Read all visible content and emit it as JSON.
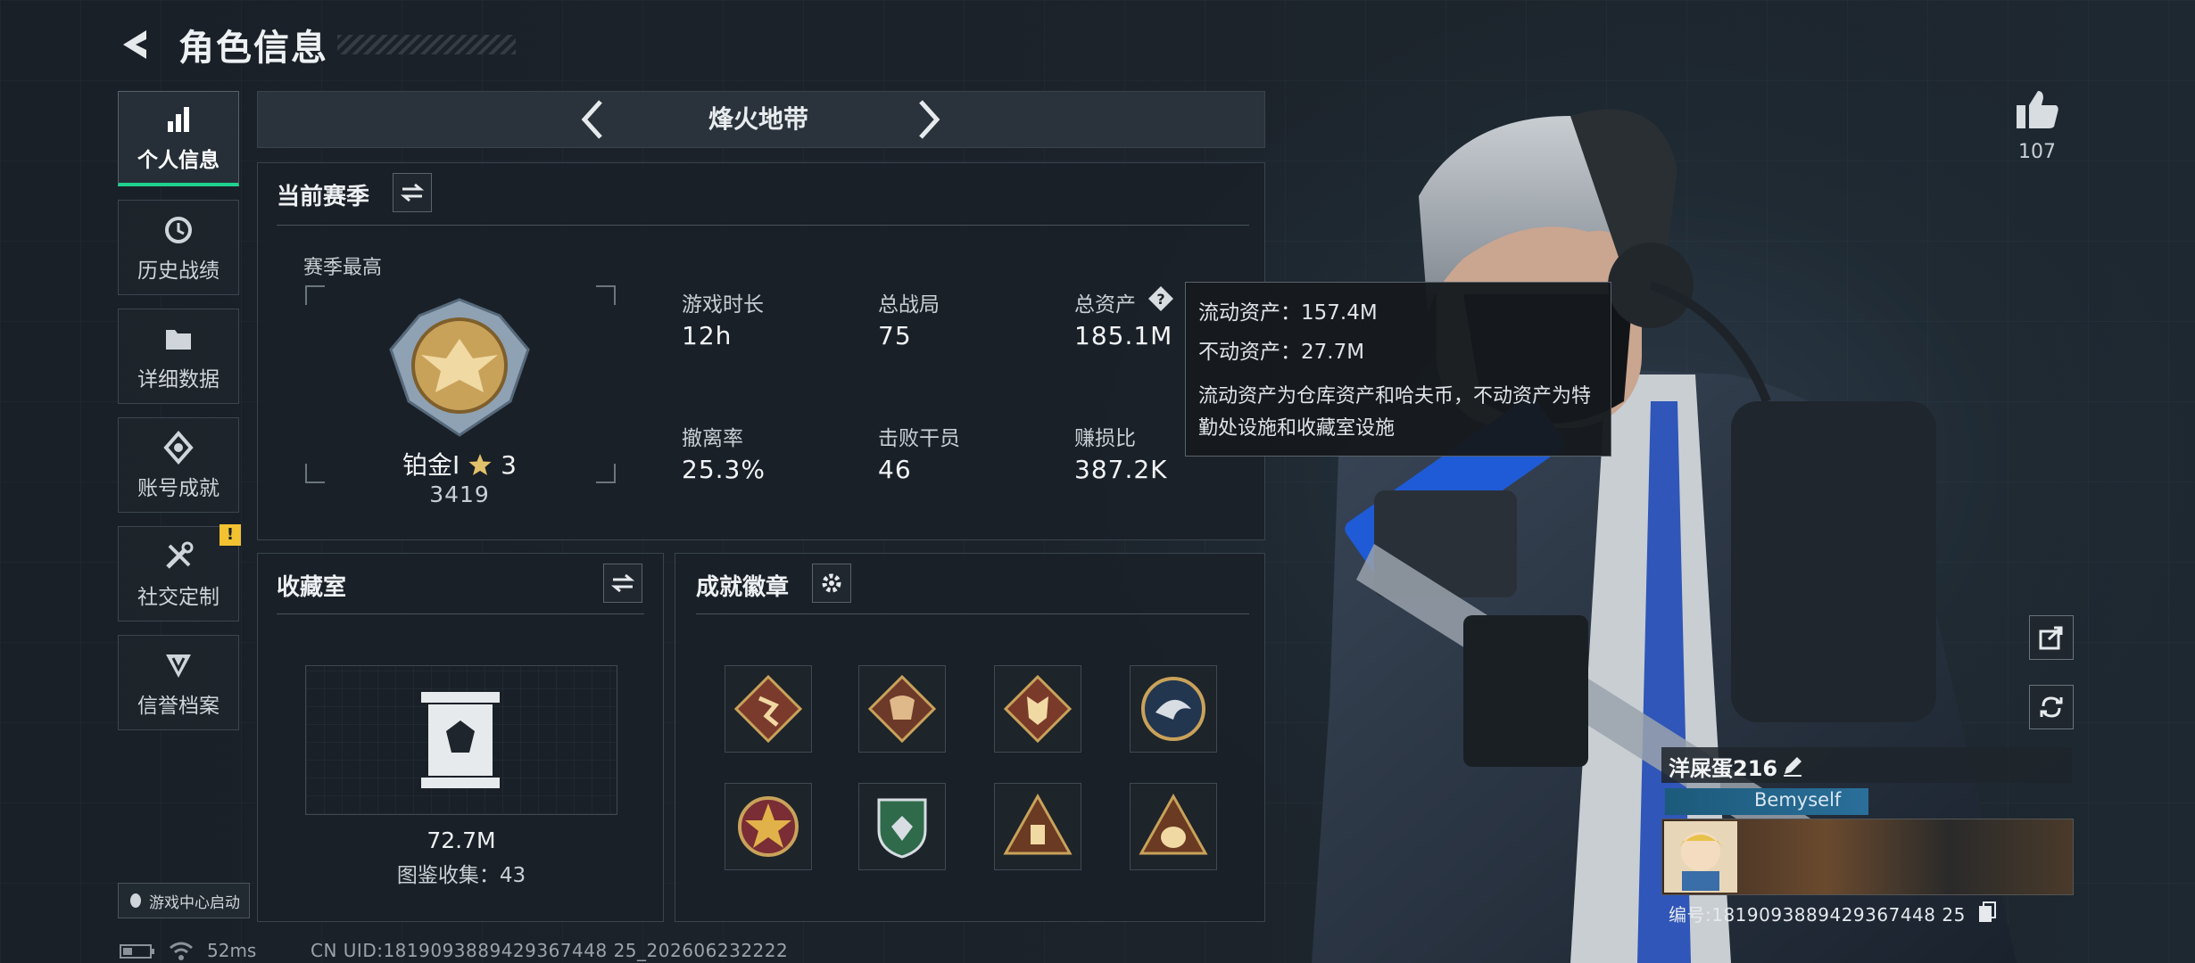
{
  "header": {
    "title": "角色信息"
  },
  "sidebar": {
    "items": [
      {
        "label": "个人信息",
        "icon": "bar-chart-icon",
        "active": true
      },
      {
        "label": "历史战绩",
        "icon": "history-icon"
      },
      {
        "label": "详细数据",
        "icon": "folder-icon"
      },
      {
        "label": "账号成就",
        "icon": "achievement-icon"
      },
      {
        "label": "社交定制",
        "icon": "tools-icon",
        "alert": "!"
      },
      {
        "label": "信誉档案",
        "icon": "credit-icon"
      }
    ],
    "game_center": "游戏中心启动"
  },
  "mode": {
    "name": "烽火地带"
  },
  "season": {
    "title": "当前赛季",
    "best_label": "赛季最高",
    "rank_name": "铂金Ⅰ",
    "rank_stars": "3",
    "rank_score": "3419",
    "stats": [
      {
        "label": "游戏时长",
        "value": "12h"
      },
      {
        "label": "总战局",
        "value": "75"
      },
      {
        "label": "总资产",
        "value": "185.1M"
      },
      {
        "label": "撤离率",
        "value": "25.3%"
      },
      {
        "label": "击败干员",
        "value": "46"
      },
      {
        "label": "赚损比",
        "value": "387.2K"
      }
    ]
  },
  "tooltip": {
    "liquid": "流动资产：157.4M",
    "fixed": "不动资产：27.7M",
    "desc": "流动资产为仓库资产和哈夫币，不动资产为特勤处设施和收藏室设施"
  },
  "collection": {
    "title": "收藏室",
    "value": "72.7M",
    "count": "图鉴收集：43"
  },
  "achievements": {
    "title": "成就徽章",
    "badges": [
      "runner-badge-icon",
      "dragon-badge-icon",
      "wolf-badge-icon",
      "eagle-badge-icon",
      "star-shield-badge-icon",
      "green-shield-badge-icon",
      "warning-badge-icon",
      "bag-badge-icon"
    ]
  },
  "likes": {
    "count": "107"
  },
  "profile": {
    "name": "洋屎蛋216",
    "tag": "Bemyself",
    "id": "编号:1819093889429367448 25"
  },
  "footer": {
    "ping": "52ms",
    "uid": "CN UID:1819093889429367448 25_202606232222"
  },
  "colors": {
    "accent": "#1fd18f",
    "gold": "#c9a25a",
    "alert": "#f2c230"
  }
}
